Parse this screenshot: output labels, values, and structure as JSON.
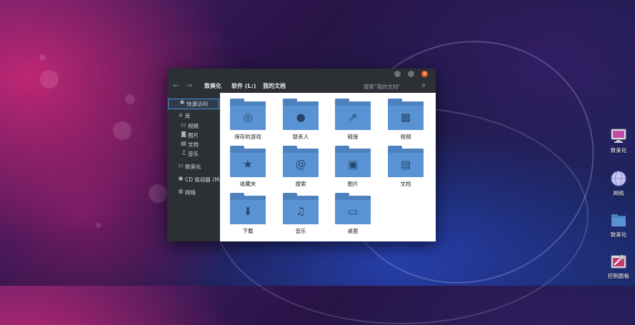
{
  "window": {
    "nav": {
      "back_arrow": "←",
      "forward_arrow": "→"
    },
    "titlebar": {
      "minimize_glyph": "",
      "maximize_glyph": "",
      "close_glyph": "×"
    },
    "breadcrumbs": [
      "致美化",
      "软件 (L:)",
      "我的文档"
    ],
    "search": {
      "placeholder": "搜索\"我的文档\"",
      "icon": "search-icon"
    },
    "sidebar": {
      "items": [
        {
          "label": "快速访问",
          "icon": "pin-icon",
          "glyph": "✱",
          "active": true
        },
        {
          "label": "库",
          "icon": "library-icon",
          "glyph": "⌂"
        },
        {
          "label": "视频",
          "icon": "video-icon",
          "glyph": "▭",
          "sub": true
        },
        {
          "label": "图片",
          "icon": "camera-icon",
          "glyph": "◙",
          "sub": true
        },
        {
          "label": "文档",
          "icon": "document-icon",
          "glyph": "▤",
          "sub": true
        },
        {
          "label": "音乐",
          "icon": "music-icon",
          "glyph": "♫",
          "sub": true
        },
        {
          "label": "致美化",
          "icon": "computer-icon",
          "glyph": "▭"
        },
        {
          "label": "CD 驱动器 (M:)",
          "icon": "cd-drive-icon",
          "glyph": "◉"
        },
        {
          "label": "网络",
          "icon": "network-icon",
          "glyph": "◍"
        }
      ]
    },
    "folders": [
      {
        "name": "保存的游戏",
        "icon": "gamepad-icon",
        "glyph": "◎"
      },
      {
        "name": "联系人",
        "icon": "contact-icon",
        "glyph": "●"
      },
      {
        "name": "链接",
        "icon": "share-icon",
        "glyph": "⇗"
      },
      {
        "name": "视频",
        "icon": "film-icon",
        "glyph": "▦"
      },
      {
        "name": "收藏夹",
        "icon": "star-icon",
        "glyph": "★"
      },
      {
        "name": "搜索",
        "icon": "search-icon",
        "glyph": "@"
      },
      {
        "name": "图片",
        "icon": "picture-icon",
        "glyph": "▣"
      },
      {
        "name": "文档",
        "icon": "document-icon",
        "glyph": "▤"
      },
      {
        "name": "下载",
        "icon": "download-icon",
        "glyph": "⬇"
      },
      {
        "name": "音乐",
        "icon": "music-icon",
        "glyph": "♫"
      },
      {
        "name": "桌面",
        "icon": "desktop-icon",
        "glyph": "▭"
      }
    ]
  },
  "desktop": {
    "icons": [
      {
        "name": "致美化",
        "icon": "computer-icon"
      },
      {
        "name": "网络",
        "icon": "network-icon"
      },
      {
        "name": "致美化",
        "icon": "folder-icon"
      },
      {
        "name": "控制面板",
        "icon": "control-panel-icon"
      }
    ]
  },
  "colors": {
    "accent": "#4a8fd8",
    "folder": "#5a93d3",
    "close": "#e8642a",
    "window_bg": "#2c2f34"
  }
}
